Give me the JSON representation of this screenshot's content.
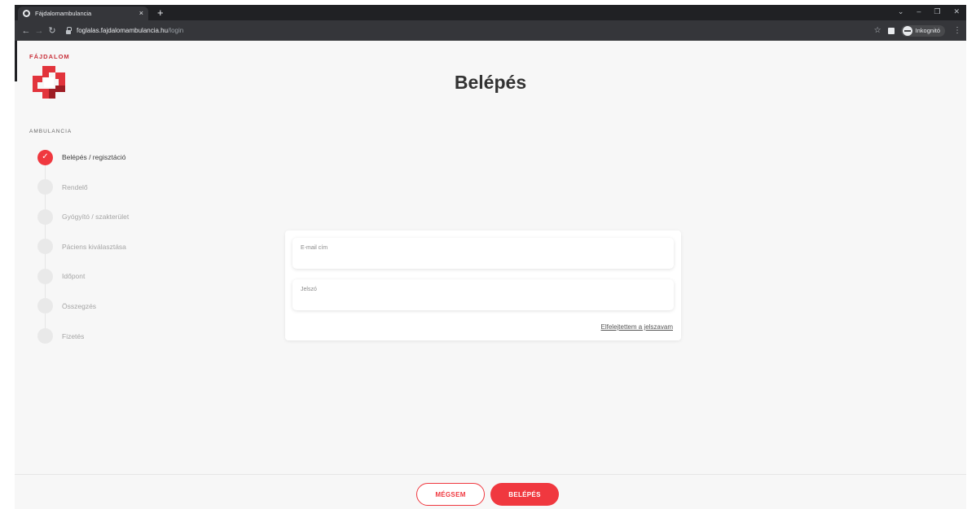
{
  "browser": {
    "tab_title": "Fájdalomambulancia",
    "tab_close": "×",
    "new_tab": "+",
    "url_host": "foglalas.fajdalomambulancia.hu",
    "url_path": "/login",
    "incognito_label": "Inkognitó",
    "window_controls": [
      "⌄",
      "–",
      "❐",
      "✕"
    ]
  },
  "logo": {
    "top_text": "FÁJDALOM",
    "bottom_text": "AMBULANCIA",
    "colors": {
      "red": "#e2343c",
      "dark_red": "#9e1d24"
    }
  },
  "page": {
    "title": "Belépés"
  },
  "steps": [
    {
      "label": "Belépés / regisztáció",
      "active": true
    },
    {
      "label": "Rendelő",
      "active": false
    },
    {
      "label": "Gyógyító / szakterület",
      "active": false
    },
    {
      "label": "Páciens kiválasztása",
      "active": false
    },
    {
      "label": "Időpont",
      "active": false
    },
    {
      "label": "Összegzés",
      "active": false
    },
    {
      "label": "Fizetés",
      "active": false
    }
  ],
  "form": {
    "email_label": "E-mail cím",
    "email_value": "",
    "password_label": "Jelszó",
    "password_value": "",
    "forgot_link": "Elfelejtettem a jelszavam"
  },
  "footer": {
    "cancel_label": "MÉGSEM",
    "login_label": "BELÉPÉS"
  },
  "colors": {
    "accent": "#f0383f",
    "page_bg": "#f7f7f7",
    "chrome_bg": "#202124"
  }
}
